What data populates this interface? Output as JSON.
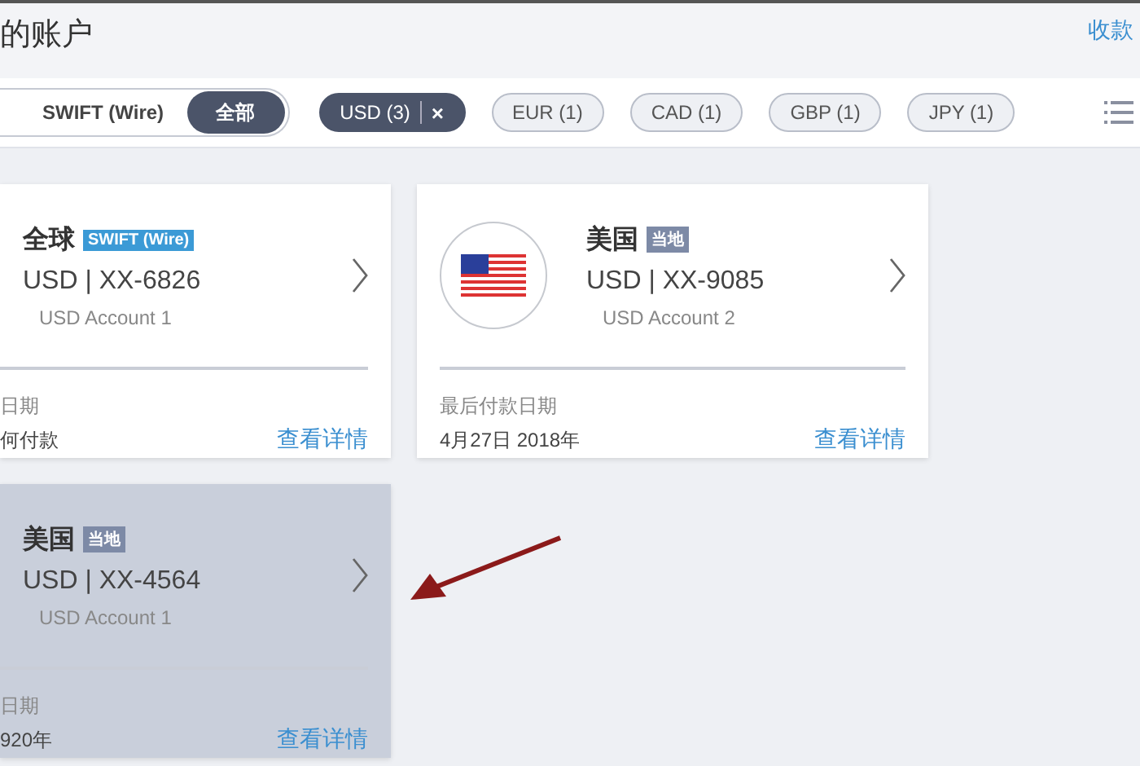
{
  "header": {
    "title": "的账户",
    "link": "收款"
  },
  "segments": [
    {
      "label": "SWIFT (Wire)",
      "selected": false
    },
    {
      "label": "全部",
      "selected": true
    }
  ],
  "currency_chips": [
    {
      "label": "USD (3)",
      "selected": true,
      "clear": "×"
    },
    {
      "label": "EUR (1)",
      "selected": false
    },
    {
      "label": "CAD (1)",
      "selected": false
    },
    {
      "label": "GBP (1)",
      "selected": false
    },
    {
      "label": "JPY (1)",
      "selected": false
    }
  ],
  "accounts": [
    {
      "kind": "cropped",
      "region": "全球",
      "badge": {
        "text": "SWIFT (Wire)",
        "kind": "swift"
      },
      "number": "USD | XX-6826",
      "nickname": "USD Account 1",
      "date_label": "日期",
      "date_value": "何付款",
      "link": "查看详情",
      "selected": false
    },
    {
      "kind": "full",
      "region": "美国",
      "badge": {
        "text": "当地",
        "kind": "local"
      },
      "number": "USD | XX-9085",
      "nickname": "USD Account 2",
      "date_label": "最后付款日期",
      "date_value": "4月27日 2018年",
      "link": "查看详情",
      "selected": false
    },
    {
      "kind": "cropped",
      "region": "美国",
      "badge": {
        "text": "当地",
        "kind": "local"
      },
      "number": "USD | XX-4564",
      "nickname": "USD Account 1",
      "date_label": "日期",
      "date_value": "920年",
      "link": "查看详情",
      "selected": true
    }
  ]
}
